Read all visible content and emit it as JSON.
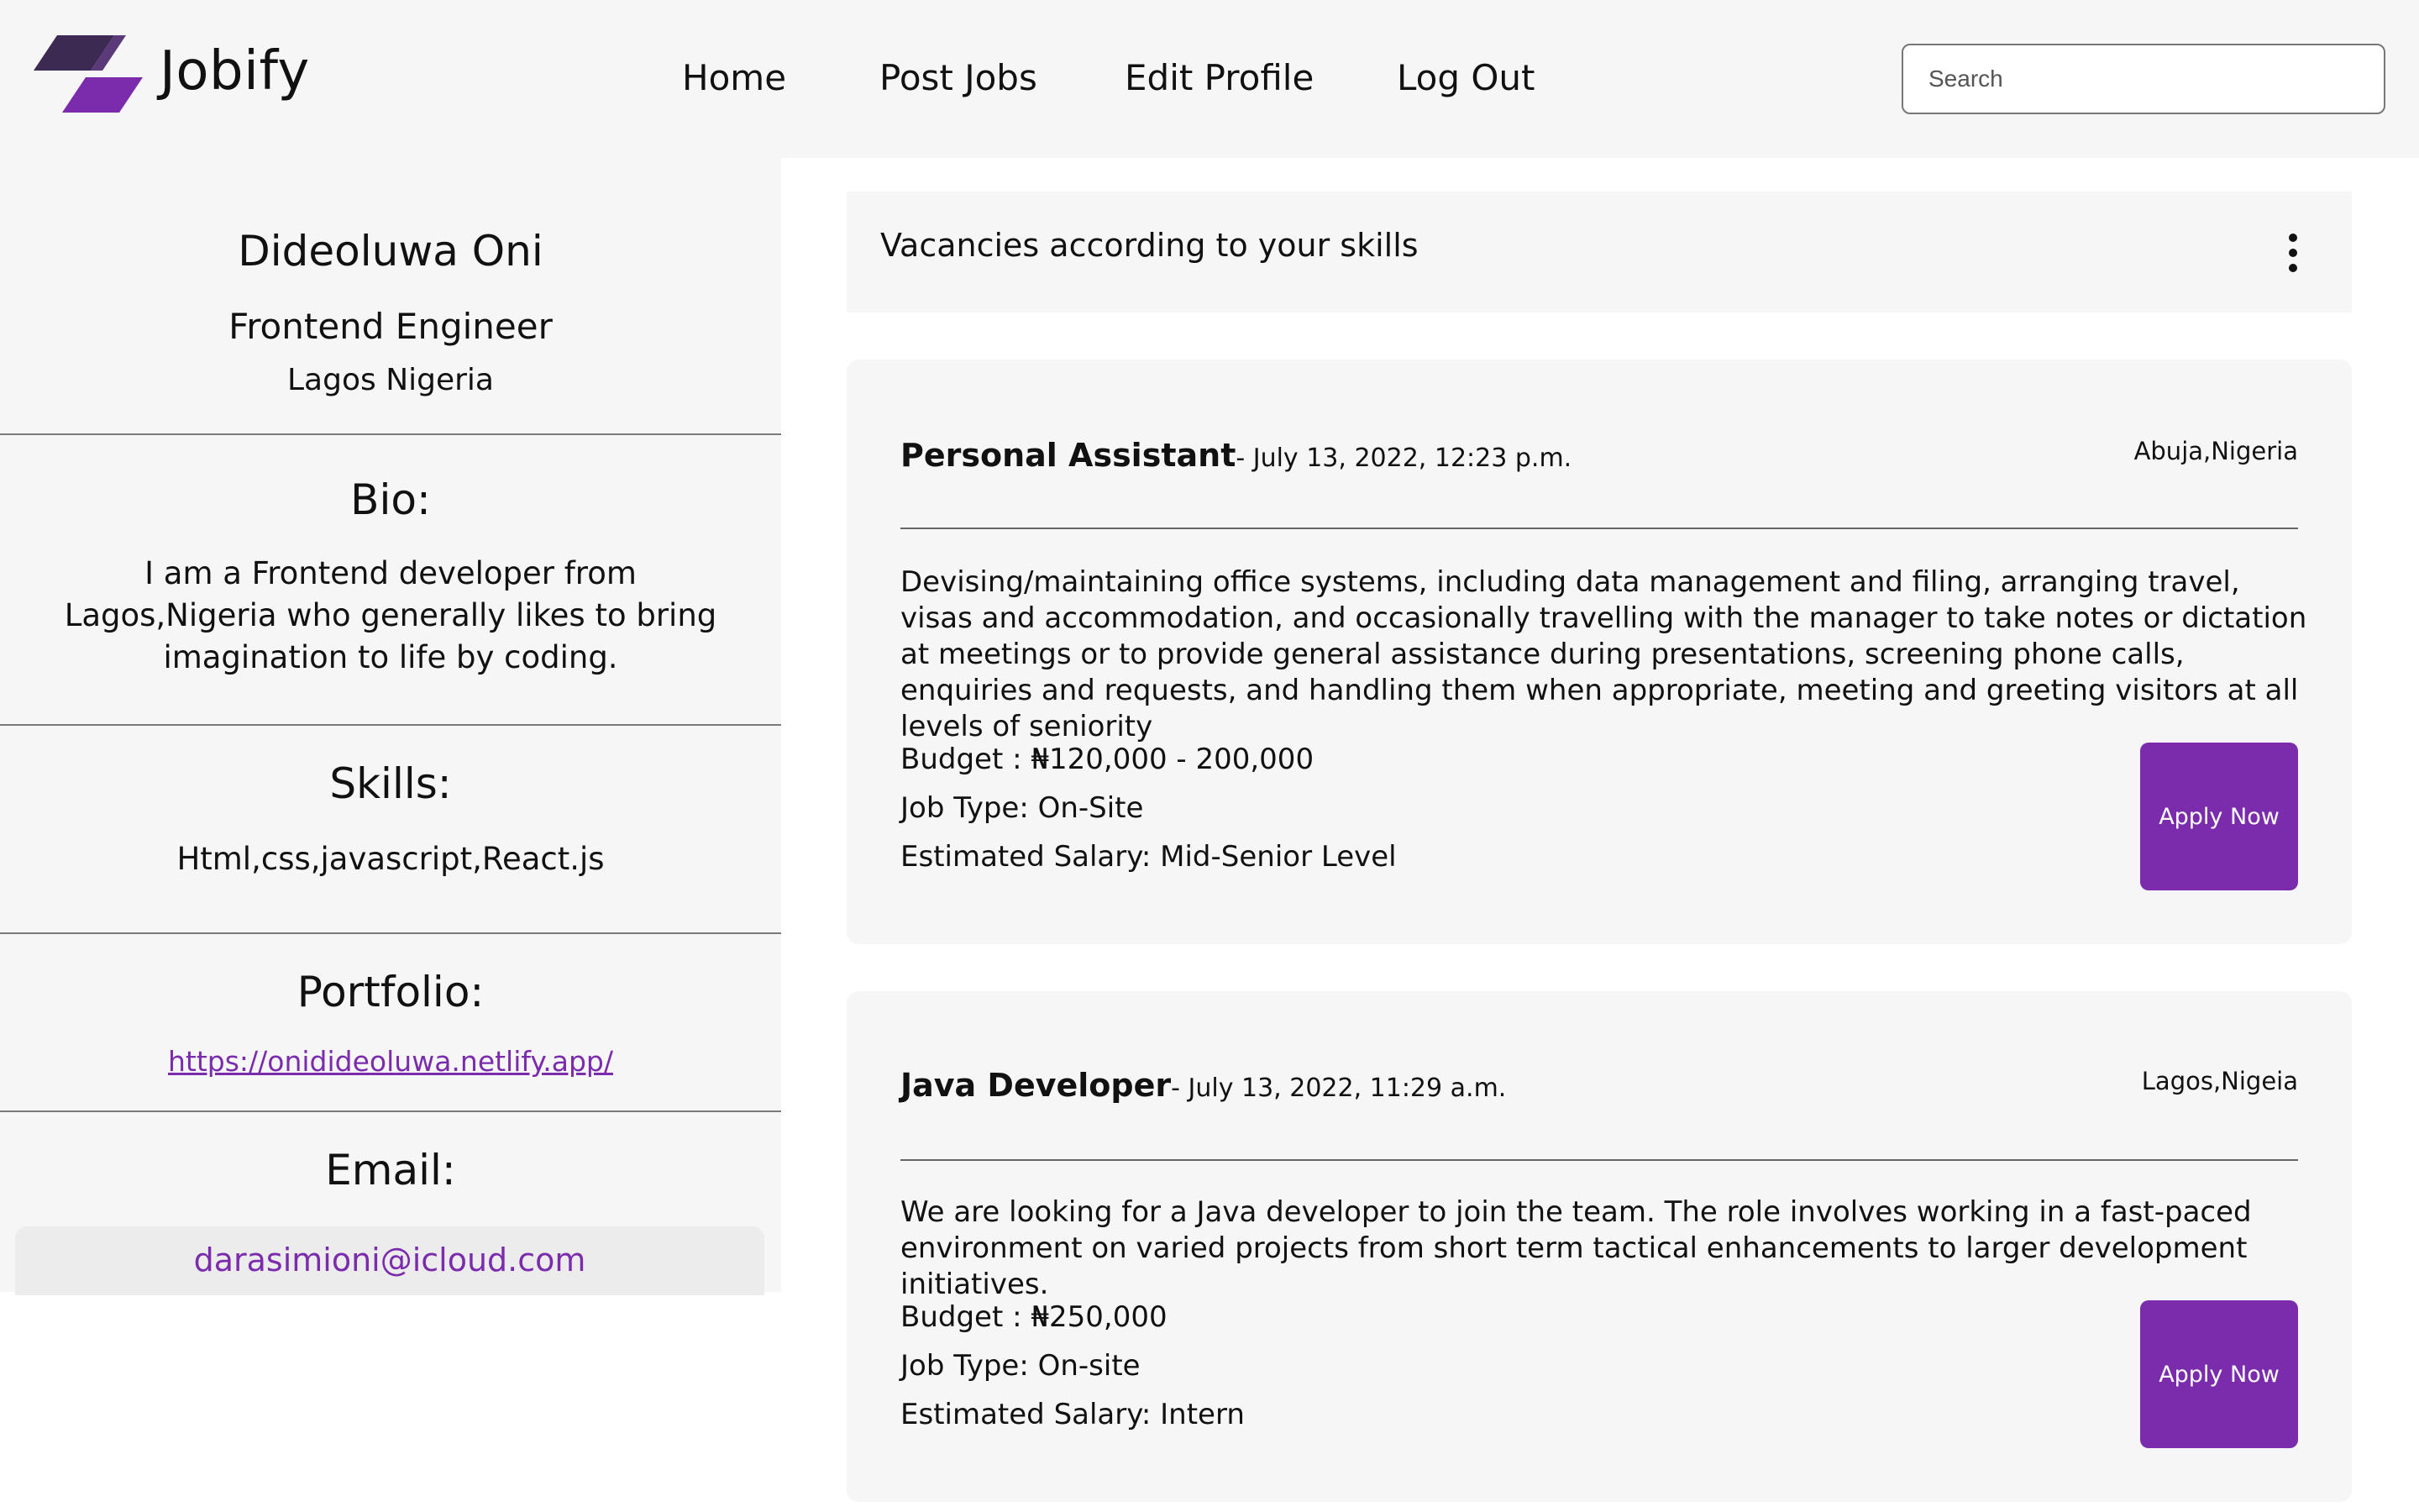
{
  "header": {
    "brand": "Jobify",
    "nav": [
      "Home",
      "Post Jobs",
      "Edit Profile",
      "Log Out"
    ],
    "search_placeholder": "Search",
    "logo_colors": {
      "dark": "#3d2a52",
      "accent": "#7b2cad"
    }
  },
  "profile": {
    "name": "Dideoluwa Oni",
    "role": "Frontend Engineer",
    "location": "Lagos Nigeria",
    "bio_label": "Bio:",
    "bio": "I am a Frontend developer from Lagos,Nigeria who generally likes to bring imagination to life by coding.",
    "skills_label": "Skills:",
    "skills": "Html,css,javascript,React.js",
    "portfolio_label": "Portfolio:",
    "portfolio_url": "https://onidideoluwa.netlify.app/",
    "email_label": "Email:",
    "email": "darasimioni@icloud.com"
  },
  "vacancies": {
    "title": "Vacancies according to your skills",
    "more_icon": "kebab-menu-icon"
  },
  "jobs": [
    {
      "title": "Personal Assistant",
      "date": "- July 13, 2022, 12:23 p.m.",
      "location": "Abuja,Nigeria",
      "description": "Devising/maintaining office systems, including data management and filing, arranging travel, visas and accommodation, and occasionally travelling with the manager to take notes or dictation at meetings or to provide general assistance during presentations, screening phone calls, enquiries and requests, and handling them when appropriate, meeting and greeting visitors at all levels of seniority",
      "budget": "Budget : ₦120,000 - 200,000",
      "job_type": "Job Type: On-Site",
      "salary": "Estimated Salary: Mid-Senior Level",
      "apply": "Apply Now"
    },
    {
      "title": "Java Developer",
      "date": "- July 13, 2022, 11:29 a.m.",
      "location": "Lagos,Nigeia",
      "description": "We are looking for a Java developer to join the team. The role involves working in a fast-paced environment on varied projects from short term tactical enhancements to larger development initiatives.",
      "budget": "Budget : ₦250,000",
      "job_type": "Job Type: On-site",
      "salary": "Estimated Salary: Intern",
      "apply": "Apply Now"
    }
  ],
  "colors": {
    "accent": "#7b2cad",
    "panel": "#f6f6f6",
    "email_box": "#ececec"
  }
}
